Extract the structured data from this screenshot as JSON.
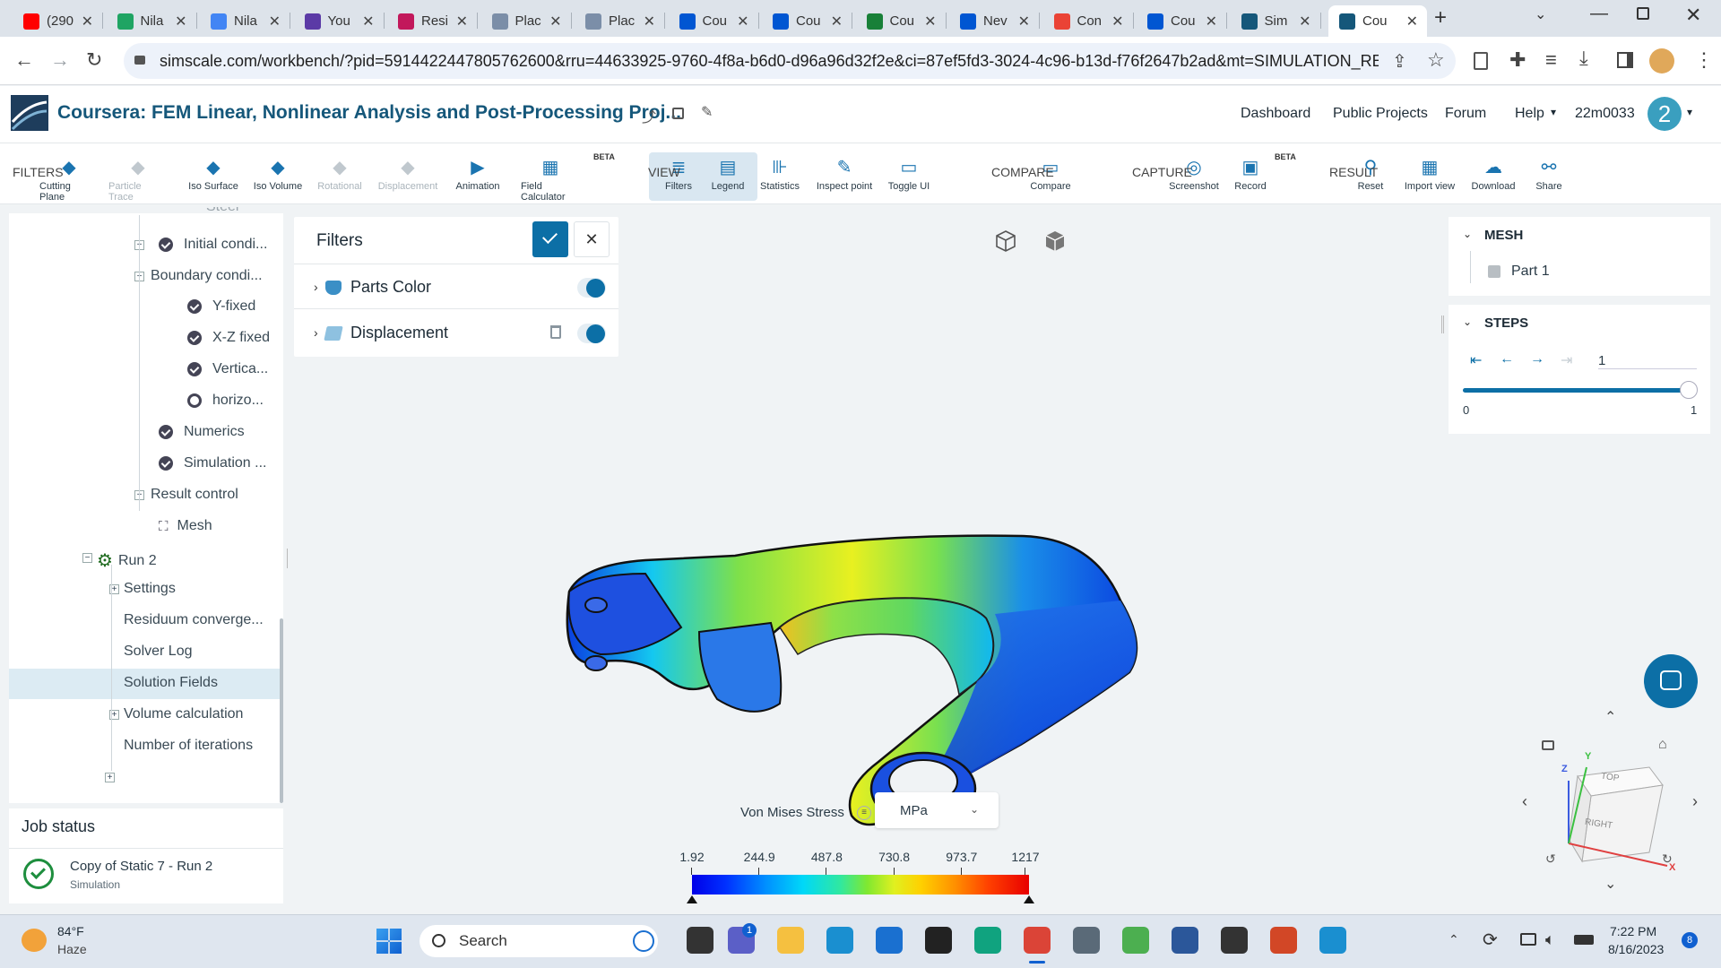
{
  "browser": {
    "tabs": [
      {
        "label": "(290",
        "color": "#ff0000"
      },
      {
        "label": "Nila",
        "color": "#1fa463"
      },
      {
        "label": "Nila",
        "color": "#4285f4"
      },
      {
        "label": "You",
        "color": "#5b3aa6"
      },
      {
        "label": "Resi",
        "color": "#c2185b"
      },
      {
        "label": "Plac",
        "color": "#7b8ea8"
      },
      {
        "label": "Plac",
        "color": "#7b8ea8"
      },
      {
        "label": "Cou",
        "color": "#0056d2"
      },
      {
        "label": "Cou",
        "color": "#0056d2"
      },
      {
        "label": "Cou",
        "color": "#188038"
      },
      {
        "label": "Nev",
        "color": "#0056d2"
      },
      {
        "label": "Con",
        "color": "#ea4335"
      },
      {
        "label": "Cou",
        "color": "#0056d2"
      },
      {
        "label": "Sim",
        "color": "#15577a"
      },
      {
        "label": "Cou",
        "color": "#15577a"
      }
    ],
    "url": "simscale.com/workbench/?pid=5914422447805762600&rru=44633925-9760-4f8a-b6d0-d96a96d32f2e&ci=87ef5fd3-3024-4c96-b13d-f76f2647b2ad&mt=SIMULATION_RESU..."
  },
  "header": {
    "project_title": "Coursera: FEM Linear, Nonlinear Analysis and Post-Processing Proj...",
    "nav": [
      "Dashboard",
      "Public Projects",
      "Forum",
      "Help"
    ],
    "user": "22m0033",
    "avatar_letter": "2"
  },
  "toolbar": {
    "filters_label": "FILTERS",
    "filters": [
      {
        "label": "Cutting Plane",
        "enabled": true
      },
      {
        "label": "Particle Trace",
        "enabled": false
      },
      {
        "label": "Iso Surface",
        "enabled": true
      },
      {
        "label": "Iso Volume",
        "enabled": true
      },
      {
        "label": "Rotational",
        "enabled": false
      },
      {
        "label": "Displacement",
        "enabled": false
      },
      {
        "label": "Animation",
        "enabled": true
      },
      {
        "label": "Field Calculator",
        "enabled": true
      }
    ],
    "beta": "BETA",
    "view_label": "VIEW",
    "view": [
      "Filters",
      "Legend",
      "Statistics",
      "Inspect point",
      "Toggle UI"
    ],
    "compare_label": "COMPARE",
    "compare": [
      "Compare"
    ],
    "capture_label": "CAPTURE",
    "capture": [
      "Screenshot",
      "Record"
    ],
    "result_label": "RESULT",
    "result": [
      "Reset",
      "Import view",
      "Download",
      "Share"
    ]
  },
  "tree": {
    "items": [
      {
        "label": "Steel"
      },
      {
        "label": "Initial condi...",
        "icon": "check"
      },
      {
        "label": "Boundary condi..."
      },
      {
        "label": "Y-fixed",
        "icon": "check"
      },
      {
        "label": "X-Z fixed",
        "icon": "check"
      },
      {
        "label": "Vertica...",
        "icon": "check"
      },
      {
        "label": "horizo...",
        "icon": "ring"
      },
      {
        "label": "Numerics",
        "icon": "check"
      },
      {
        "label": "Simulation ...",
        "icon": "check"
      },
      {
        "label": "Result control"
      },
      {
        "label": "Mesh"
      },
      {
        "label": "Run 2"
      },
      {
        "label": "Settings"
      },
      {
        "label": "Residuum converge..."
      },
      {
        "label": "Solver Log"
      },
      {
        "label": "Solution Fields"
      },
      {
        "label": "Volume calculation"
      },
      {
        "label": "Number of iterations"
      }
    ]
  },
  "job": {
    "title": "Job status",
    "name": "Copy of Static 7 - Run 2",
    "type": "Simulation"
  },
  "filters_panel": {
    "title": "Filters",
    "rows": [
      "Parts Color",
      "Displacement"
    ]
  },
  "mesh_panel": {
    "title": "MESH",
    "part": "Part 1"
  },
  "steps_panel": {
    "title": "STEPS",
    "step": "1",
    "min": "0",
    "max": "1",
    "position": 1.0
  },
  "legend": {
    "field": "Von Mises Stress",
    "unit": "MPa",
    "ticks": [
      "1.92",
      "244.9",
      "487.8",
      "730.8",
      "973.7",
      "1217"
    ]
  },
  "viewcube": {
    "top": "TOP",
    "right": "RIGHT",
    "z": "Z",
    "x": "X",
    "y": "Y"
  },
  "taskbar": {
    "temp": "84°F",
    "weather": "Haze",
    "search": "Search",
    "time": "7:22 PM",
    "date": "8/16/2023",
    "teams_badge": "1",
    "notif": "8"
  },
  "colors": {
    "accent": "#15577a",
    "primary_btn": "#0c6fa6"
  }
}
